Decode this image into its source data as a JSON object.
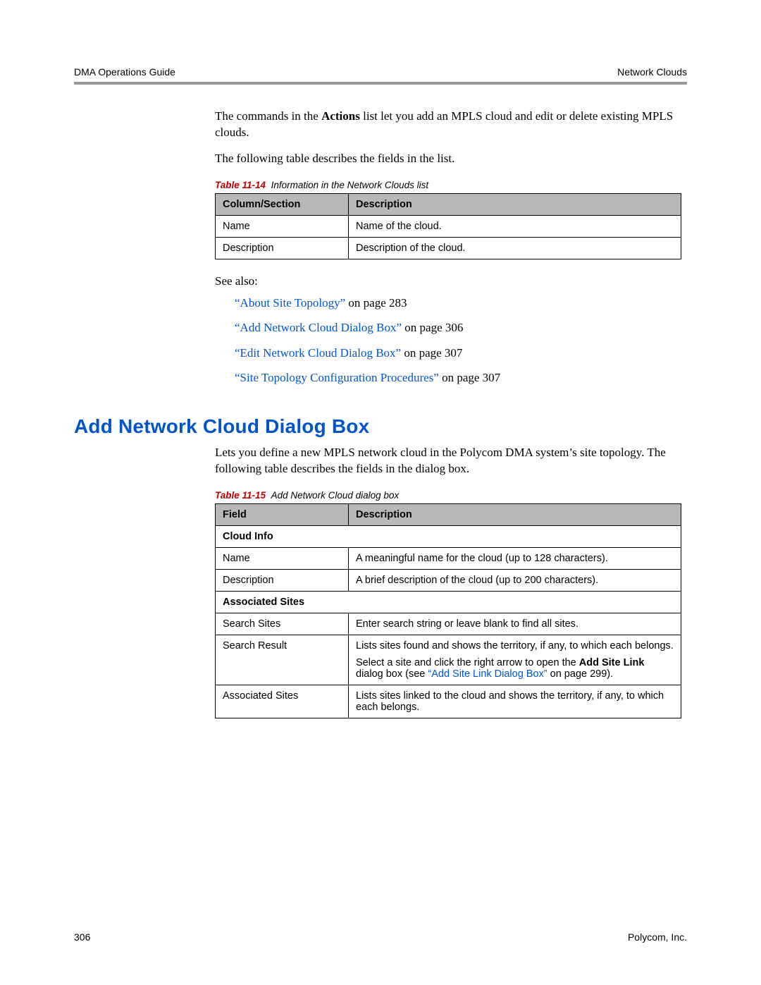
{
  "header": {
    "left": "DMA Operations Guide",
    "right": "Network Clouds"
  },
  "intro": {
    "p1a": "The commands in the ",
    "p1b": "Actions",
    "p1c": " list let you add an MPLS cloud and edit or delete existing MPLS clouds.",
    "p2": "The following table describes the fields in the list."
  },
  "table1": {
    "caption_num": "Table 11-14",
    "caption_title": "Information in the Network Clouds list",
    "h1": "Column/Section",
    "h2": "Description",
    "rows": [
      {
        "c1": "Name",
        "c2": "Name of the cloud."
      },
      {
        "c1": "Description",
        "c2": "Description of the cloud."
      }
    ]
  },
  "see_also": {
    "label": "See also:",
    "items": [
      {
        "link": "“About Site Topology”",
        "tail": " on page 283"
      },
      {
        "link": "“Add Network Cloud Dialog Box”",
        "tail": " on page 306"
      },
      {
        "link": "“Edit Network Cloud Dialog Box”",
        "tail": " on page 307"
      },
      {
        "link": "“Site Topology Configuration Procedures”",
        "tail": " on page 307"
      }
    ]
  },
  "section": {
    "title": "Add Network Cloud Dialog Box",
    "p1": "Lets you define a new MPLS network cloud in the Polycom DMA system’s site topology. The following table describes the fields in the dialog box."
  },
  "table2": {
    "caption_num": "Table 11-15",
    "caption_title": "Add Network Cloud dialog box",
    "h1": "Field",
    "h2": "Description",
    "sect_cloud": "Cloud Info",
    "r_cloud": [
      {
        "c1": "Name",
        "c2": "A meaningful name for the cloud (up to 128 characters)."
      },
      {
        "c1": "Description",
        "c2": "A brief description of the cloud (up to 200 characters)."
      }
    ],
    "sect_assoc": "Associated Sites",
    "r_ss": {
      "c1": "Search Sites",
      "c2": "Enter search string or leave blank to find all sites."
    },
    "r_sr": {
      "c1": "Search Result",
      "p1": "Lists sites found and shows the territory, if any, to which each belongs.",
      "p2a": "Select a site and click the right arrow to open the ",
      "p2b": "Add Site Link",
      "p2c": " dialog box (see ",
      "p2link": "“Add Site Link Dialog Box”",
      "p2d": " on page 299)."
    },
    "r_as": {
      "c1": "Associated Sites",
      "c2": "Lists sites linked to the cloud and shows the territory, if any, to which each belongs."
    }
  },
  "footer": {
    "page": "306",
    "company": "Polycom, Inc."
  }
}
